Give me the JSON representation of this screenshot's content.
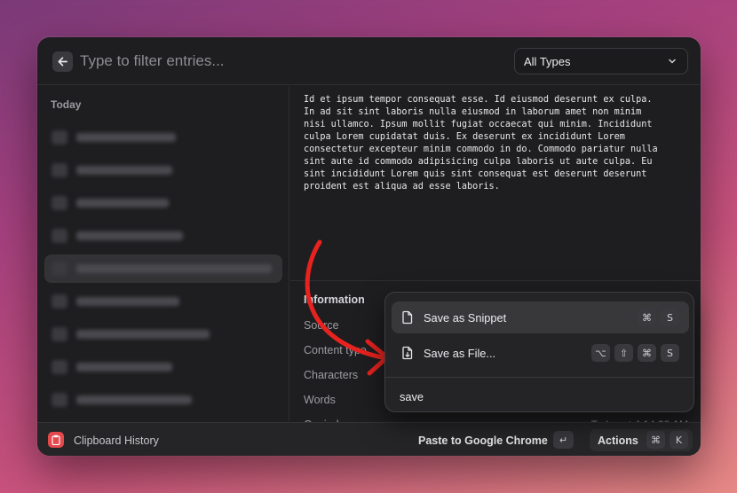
{
  "search": {
    "placeholder": "Type to filter entries...",
    "value": ""
  },
  "type_filter": {
    "selected": "All Types"
  },
  "list": {
    "section_title": "Today"
  },
  "preview": {
    "text": "Id et ipsum tempor consequat esse. Id eiusmod deserunt ex culpa.\nIn ad sit sint laboris nulla eiusmod in laborum amet non minim\nnisi ullamco. Ipsum mollit fugiat occaecat qui minim. Incididunt\nculpa Lorem cupidatat duis. Ex deserunt ex incididunt Lorem\nconsectetur excepteur minim commodo in do. Commodo pariatur nulla\nsint aute id commodo adipisicing culpa laboris ut aute culpa. Eu\nsint incididunt Lorem quis sint consequat est deserunt deserunt\nproident est aliqua ad esse laboris."
  },
  "information": {
    "title": "Information",
    "labels": [
      "Source",
      "Content type",
      "Characters",
      "Words",
      "Copied"
    ],
    "copied_value": "Today at 4:14:38 AM"
  },
  "footer": {
    "title": "Clipboard History",
    "paste_label": "Paste to Google Chrome",
    "paste_key": "↵",
    "actions_label": "Actions",
    "actions_keys": [
      "⌘",
      "K"
    ]
  },
  "action_menu": {
    "items": [
      {
        "label": "Save as Snippet",
        "icon": "document-icon",
        "keys": [
          "⌘",
          "S"
        ]
      },
      {
        "label": "Save as File...",
        "icon": "file-download-icon",
        "keys": [
          "⌥",
          "⇧",
          "⌘",
          "S"
        ]
      }
    ],
    "search_value": "save"
  },
  "colors": {
    "window_bg": "#1e1e20",
    "accent_arrow": "#e8231f",
    "app_icon": "#e5484d"
  }
}
